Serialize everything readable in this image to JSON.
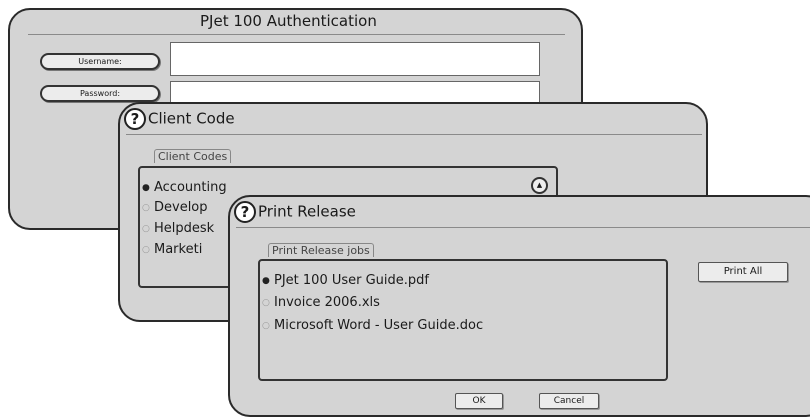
{
  "auth": {
    "title": "PJet 100 Authentication",
    "username_label": "Username:",
    "password_label": "Password:"
  },
  "client_code": {
    "title": "Client Code",
    "group_label": "Client Codes",
    "items": [
      {
        "label": "Accounting",
        "selected": true
      },
      {
        "label": "Develop",
        "selected": false
      },
      {
        "label": "Helpdesk",
        "selected": false
      },
      {
        "label": "Marketi",
        "selected": false
      }
    ]
  },
  "print_release": {
    "title": "Print Release",
    "group_label": "Print Release jobs",
    "jobs": [
      {
        "label": "PJet 100 User Guide.pdf",
        "selected": true
      },
      {
        "label": "Invoice 2006.xls",
        "selected": false
      },
      {
        "label": "Microsoft Word - User Guide.doc",
        "selected": false
      }
    ],
    "print_all_label": "Print All",
    "ok_label": "OK",
    "cancel_label": "Cancel"
  },
  "icons": {
    "help": "question-mark",
    "radio_selected": "●",
    "radio_unselected": "○",
    "scroll_up": "▲"
  }
}
